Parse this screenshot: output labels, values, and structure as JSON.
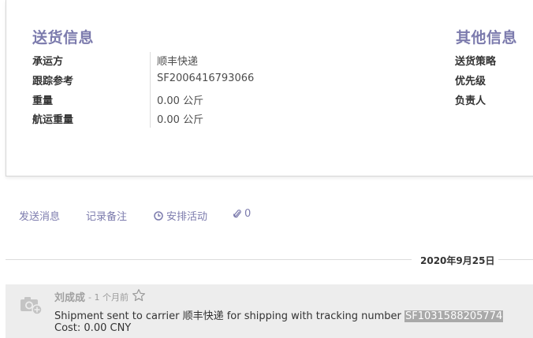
{
  "delivery": {
    "title": "送货信息",
    "fields": [
      {
        "label": "承运方",
        "value": "顺丰快递"
      },
      {
        "label": "跟踪参考",
        "value": "SF2006416793066"
      },
      {
        "label": "重量",
        "value": "0.00 公斤"
      },
      {
        "label": "航运重量",
        "value": "0.00 公斤"
      }
    ]
  },
  "other": {
    "title": "其他信息",
    "fields": [
      {
        "label": "送货策略"
      },
      {
        "label": "优先级"
      },
      {
        "label": "负责人"
      }
    ]
  },
  "chatter": {
    "send_message": "发送消息",
    "log_note": "记录备注",
    "schedule_activity": "安排活动",
    "attachments_count": "0",
    "date_separator": "2020年9月25日",
    "message": {
      "author": "刘成成",
      "relative_date": "- 1 个月前",
      "body_prefix": "Shipment sent to carrier 顺丰快递 for shipping with tracking number ",
      "tracking_number": "SF1031588205774",
      "cost_line": "Cost: 0.00 CNY"
    }
  },
  "colors": {
    "accent": "#7c7bad",
    "message_bg": "#ededed"
  },
  "icons": [
    "clock-icon",
    "paperclip-icon",
    "camera-avatar-icon",
    "star-icon"
  ]
}
